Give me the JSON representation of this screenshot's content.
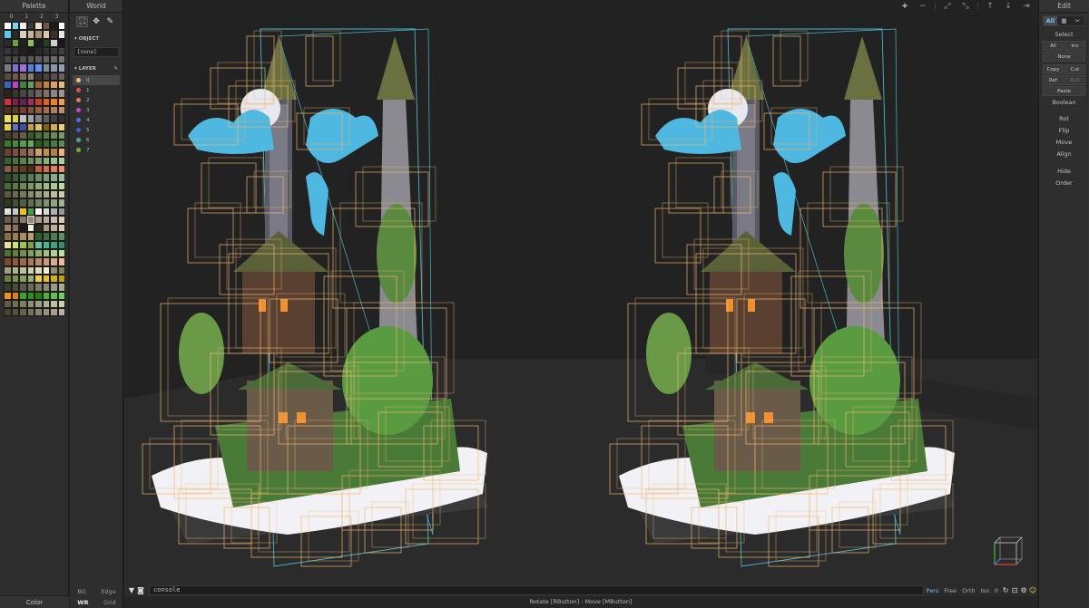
{
  "palette": {
    "title": "Palette",
    "column_headers": [
      "0",
      "1",
      "2",
      "3"
    ],
    "footer": "Color",
    "swatches": [
      "#ffffff",
      "#7fd3f2",
      "#f0f0f0",
      "#3a3a3a",
      "#e8ddc8",
      "#6b5a4a",
      "#1a1a1a",
      "#ffffff",
      "#5ac8e8",
      "#2a2a2a",
      "#d8cfc0",
      "#c9b896",
      "#a89070",
      "#d8c8b0",
      "#403028",
      "#e8e8e8",
      "#2b2b2b",
      "#6aa040",
      "#202020",
      "#8ac060",
      "#1c1c1c",
      "#284020",
      "#d0d0d0",
      "#181818",
      "#383838",
      "#303030",
      "#202020",
      "#1a1a1a",
      "#282828",
      "#303030",
      "#383838",
      "#404040",
      "#464646",
      "#4a4a4a",
      "#505050",
      "#565656",
      "#5c5c5c",
      "#626262",
      "#6a6a6a",
      "#727272",
      "#7a7a7a",
      "#8070d0",
      "#a070e0",
      "#5080e0",
      "#6090f0",
      "#7c8c9c",
      "#8898a8",
      "#90a0b0",
      "#5a4a3a",
      "#6a5a4a",
      "#7a6a5a",
      "#8a7a6a",
      "#3a3030",
      "#4a4040",
      "#5a5050",
      "#6a6060",
      "#4060c0",
      "#c040c0",
      "#408040",
      "#60a060",
      "#a06030",
      "#c08040",
      "#e0a060",
      "#e0c080",
      "#2a2520",
      "#3a3530",
      "#4a4540",
      "#5a5550",
      "#6a6560",
      "#7a7570",
      "#8a8580",
      "#9a9590",
      "#d03040",
      "#802040",
      "#602050",
      "#a03060",
      "#c04020",
      "#e06020",
      "#f08020",
      "#f0a040",
      "#503020",
      "#603828",
      "#704030",
      "#805038",
      "#906040",
      "#a07050",
      "#b08060",
      "#c09070",
      "#f0e060",
      "#e0d040",
      "#c0c0c0",
      "#a0a0a0",
      "#808080",
      "#606060",
      "#404040",
      "#303030",
      "#e8d050",
      "#6070c0",
      "#4050a0",
      "#c0a040",
      "#e0c060",
      "#806020",
      "#d0b050",
      "#f0d070",
      "#4a3a2a",
      "#5a4a3a",
      "#6a5a4a",
      "#3a5a2a",
      "#4a6a3a",
      "#5a7a4a",
      "#6a8a5a",
      "#7a9a6a",
      "#3a7a2a",
      "#4a8a3a",
      "#5a9a4a",
      "#6aaa5a",
      "#2a5a20",
      "#3a6a30",
      "#4a7a40",
      "#5a8a50",
      "#6a4030",
      "#7a5040",
      "#8a6050",
      "#9a7060",
      "#d0a060",
      "#c09050",
      "#b08040",
      "#f0b080",
      "#3a6030",
      "#4a7040",
      "#5a8050",
      "#6a9060",
      "#7aa070",
      "#8ab080",
      "#9ac090",
      "#aad0a0",
      "#806040",
      "#705030",
      "#604020",
      "#503010",
      "#c06040",
      "#d07050",
      "#e08060",
      "#f09070",
      "#2a4a2a",
      "#3a5a3a",
      "#4a6a4a",
      "#5a7a5a",
      "#6a8a6a",
      "#7a9a7a",
      "#8aaa8a",
      "#9aba9a",
      "#4a6a30",
      "#5a7a40",
      "#6a8a50",
      "#7a9a60",
      "#8aaa70",
      "#9aba80",
      "#aaca90",
      "#bada a0",
      "#5a5a40",
      "#6a6a50",
      "#7a7a60",
      "#8a8a70",
      "#9a9a80",
      "#aaaa90",
      "#babaa0",
      "#cacab0",
      "#303820",
      "#405030",
      "#506040",
      "#607050",
      "#708060",
      "#809070",
      "#90a080",
      "#a0b090",
      "#e0e0e0",
      "#c8c8c8",
      "#f0c020",
      "#40a040",
      "#f8f8f8",
      "#d8d8d8",
      "#b0b0b0",
      "#989898",
      "#6a5a4a",
      "#7a6a5a",
      "#8a7a6a",
      "#9a8a7a",
      "#aa9a8a",
      "#baaa9a",
      "#cabaaa",
      "#dacaba",
      "#a08060",
      "#907050",
      "#201818",
      "#f0f0e0",
      "#302820",
      "#a89880",
      "#c0b098",
      "#d8c8b0",
      "#8a7040",
      "#9a8050",
      "#aa9060",
      "#ba a070",
      "#2a6030",
      "#3a7040",
      "#4a8050",
      "#5a9060",
      "#e8e0a0",
      "#d0e070",
      "#a0c050",
      "#80a040",
      "#60c0a0",
      "#50b090",
      "#40a080",
      "#309070",
      "#507030",
      "#608040",
      "#709050",
      "#80a060",
      "#90b070",
      "#a0c080",
      "#b0d090",
      "#c0e0a0",
      "#7a4a2a",
      "#8a5a3a",
      "#9a6a4a",
      "#aa7a5a",
      "#ba8a6a",
      "#ca9a7a",
      "#daaa8a",
      "#eaba9a",
      "#a0a080",
      "#b0b090",
      "#c0c0a0",
      "#d0d0b0",
      "#e0e0c0",
      "#f0f0d0",
      "#909070",
      "#808060",
      "#6a8040",
      "#7a9050",
      "#8aa060",
      "#9ab070",
      "#f0d040",
      "#e8c030",
      "#d0b020",
      "#c0a010",
      "#3a3a28",
      "#4a4a38",
      "#5a5a48",
      "#6a6a58",
      "#7a7a68",
      "#8a8a78",
      "#9a9a88",
      "#aaaa98",
      "#f09020",
      "#e08010",
      "#40a030",
      "#309020",
      "#208010",
      "#50b040",
      "#60c050",
      "#70d060",
      "#5a6040",
      "#6a7050",
      "#7a8060",
      "#8a9070",
      "#9aa080",
      "#aab090",
      "#bac0a0",
      "#cad0b0",
      "#4a4030",
      "#5a5040",
      "#6a6050",
      "#7a7060",
      "#8a8070",
      "#9a9080",
      "#aaa090",
      "#bab0a0"
    ],
    "selected_index": 187
  },
  "world": {
    "title": "World",
    "object_section": "OBJECT",
    "object_value": "[none]",
    "layer_section": "LAYER",
    "layers": [
      {
        "label": "0",
        "color": "#f0c070"
      },
      {
        "label": "1",
        "color": "#e05050"
      },
      {
        "label": "2",
        "color": "#e08060"
      },
      {
        "label": "3",
        "color": "#c050c0"
      },
      {
        "label": "4",
        "color": "#5070e0"
      },
      {
        "label": "5",
        "color": "#4060d0"
      },
      {
        "label": "6",
        "color": "#50a0a0"
      },
      {
        "label": "7",
        "color": "#70b040"
      }
    ],
    "footer_row1": [
      "BG",
      "Edge"
    ],
    "footer_row2": [
      "WR",
      "Grid"
    ]
  },
  "viewport": {
    "toolbar": [
      "+",
      "−",
      "⤢",
      "⤡",
      "↑",
      "↓",
      "⇥"
    ]
  },
  "console": {
    "value": "console",
    "view_modes": [
      "Pers",
      "Free",
      "Orth",
      "Iso"
    ],
    "active_view": "Pers",
    "counter": "0"
  },
  "status": "Rotate [RButton] : Move [MButton]",
  "edit": {
    "title": "Edit",
    "tabs": [
      "All",
      "▦",
      "✂"
    ],
    "select_label": "Select",
    "select_grid": [
      "All",
      "Inv"
    ],
    "none_label": "None",
    "clip_grid": [
      "Copy",
      "Cut",
      "Ref",
      "R-O"
    ],
    "paste_label": "Paste",
    "boolean_label": "Boolean",
    "actions": [
      "Rot",
      "Flip",
      "Move",
      "Align"
    ],
    "actions2": [
      "Hide",
      "Order"
    ]
  },
  "colors": {
    "accent": "#6ec6ff",
    "bbox": "#f0b870",
    "bbox_world": "#4ab8c8"
  }
}
